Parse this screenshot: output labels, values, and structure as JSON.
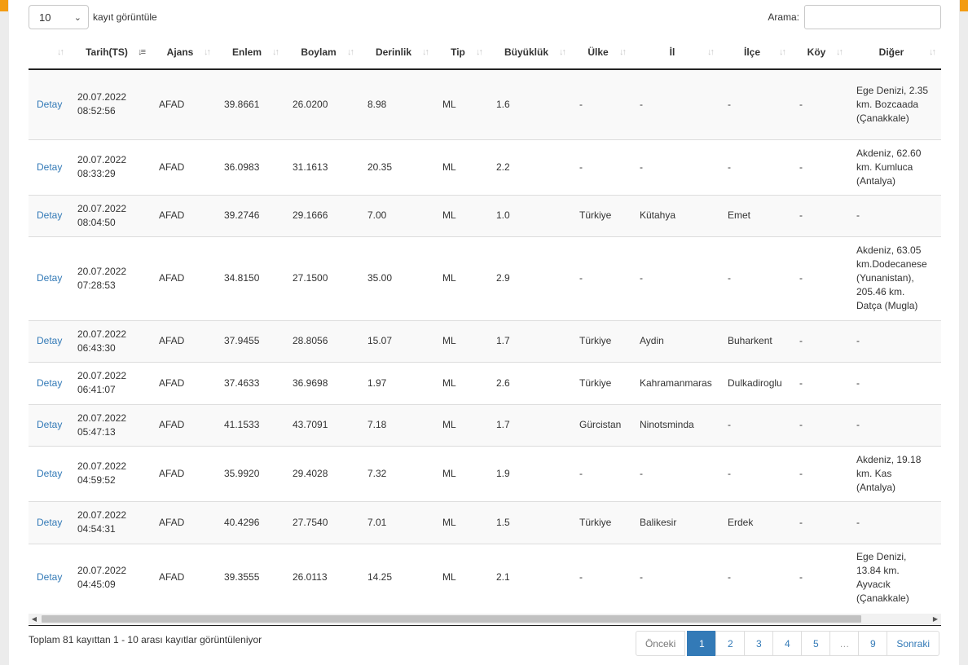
{
  "controls": {
    "length_value": "10",
    "length_label": "kayıt görüntüle",
    "search_label": "Arama:",
    "search_value": ""
  },
  "table": {
    "columns": [
      "",
      "Tarih(TS)",
      "Ajans",
      "Enlem",
      "Boylam",
      "Derinlik",
      "Tip",
      "Büyüklük",
      "Ülke",
      "İl",
      "İlçe",
      "Köy",
      "Diğer"
    ],
    "sorted_column": "Tarih(TS)",
    "rows": [
      [
        "Detay",
        "20.07.2022 08:52:56",
        "AFAD",
        "39.8661",
        "26.0200",
        "8.98",
        "ML",
        "1.6",
        "-",
        "-",
        "-",
        "-",
        "Ege Denizi, 2.35 km. Bozcaada (Çanakkale)"
      ],
      [
        "Detay",
        "20.07.2022 08:33:29",
        "AFAD",
        "36.0983",
        "31.1613",
        "20.35",
        "ML",
        "2.2",
        "-",
        "-",
        "-",
        "-",
        "Akdeniz, 62.60 km. Kumluca (Antalya)"
      ],
      [
        "Detay",
        "20.07.2022 08:04:50",
        "AFAD",
        "39.2746",
        "29.1666",
        "7.00",
        "ML",
        "1.0",
        "Türkiye",
        "Kütahya",
        "Emet",
        "-",
        "-"
      ],
      [
        "Detay",
        "20.07.2022 07:28:53",
        "AFAD",
        "34.8150",
        "27.1500",
        "35.00",
        "ML",
        "2.9",
        "-",
        "-",
        "-",
        "-",
        "Akdeniz, 63.05 km.Dodecanese (Yunanistan), 205.46 km. Datça (Mugla)"
      ],
      [
        "Detay",
        "20.07.2022 06:43:30",
        "AFAD",
        "37.9455",
        "28.8056",
        "15.07",
        "ML",
        "1.7",
        "Türkiye",
        "Aydin",
        "Buharkent",
        "-",
        "-"
      ],
      [
        "Detay",
        "20.07.2022 06:41:07",
        "AFAD",
        "37.4633",
        "36.9698",
        "1.97",
        "ML",
        "2.6",
        "Türkiye",
        "Kahramanmaras",
        "Dulkadiroglu",
        "-",
        "-"
      ],
      [
        "Detay",
        "20.07.2022 05:47:13",
        "AFAD",
        "41.1533",
        "43.7091",
        "7.18",
        "ML",
        "1.7",
        "Gürcistan",
        "Ninotsminda",
        "-",
        "-",
        "-"
      ],
      [
        "Detay",
        "20.07.2022 04:59:52",
        "AFAD",
        "35.9920",
        "29.4028",
        "7.32",
        "ML",
        "1.9",
        "-",
        "-",
        "-",
        "-",
        "Akdeniz, 19.18 km. Kas (Antalya)"
      ],
      [
        "Detay",
        "20.07.2022 04:54:31",
        "AFAD",
        "40.4296",
        "27.7540",
        "7.01",
        "ML",
        "1.5",
        "Türkiye",
        "Balikesir",
        "Erdek",
        "-",
        "-"
      ],
      [
        "Detay",
        "20.07.2022 04:45:09",
        "AFAD",
        "39.3555",
        "26.0113",
        "14.25",
        "ML",
        "2.1",
        "-",
        "-",
        "-",
        "-",
        "Ege Denizi, 13.84 km. Ayvacık (Çanakkale)"
      ]
    ]
  },
  "footer": {
    "info": "Toplam 81 kayıttan 1 - 10 arası kayıtlar görüntüleniyor",
    "pagination": [
      "Önceki",
      "1",
      "2",
      "3",
      "4",
      "5",
      "…",
      "9",
      "Sonraki"
    ],
    "active_page": "1"
  },
  "colors": {
    "accent": "#f39c12",
    "link": "#337ab7",
    "active_page_bg": "#337ab7"
  }
}
